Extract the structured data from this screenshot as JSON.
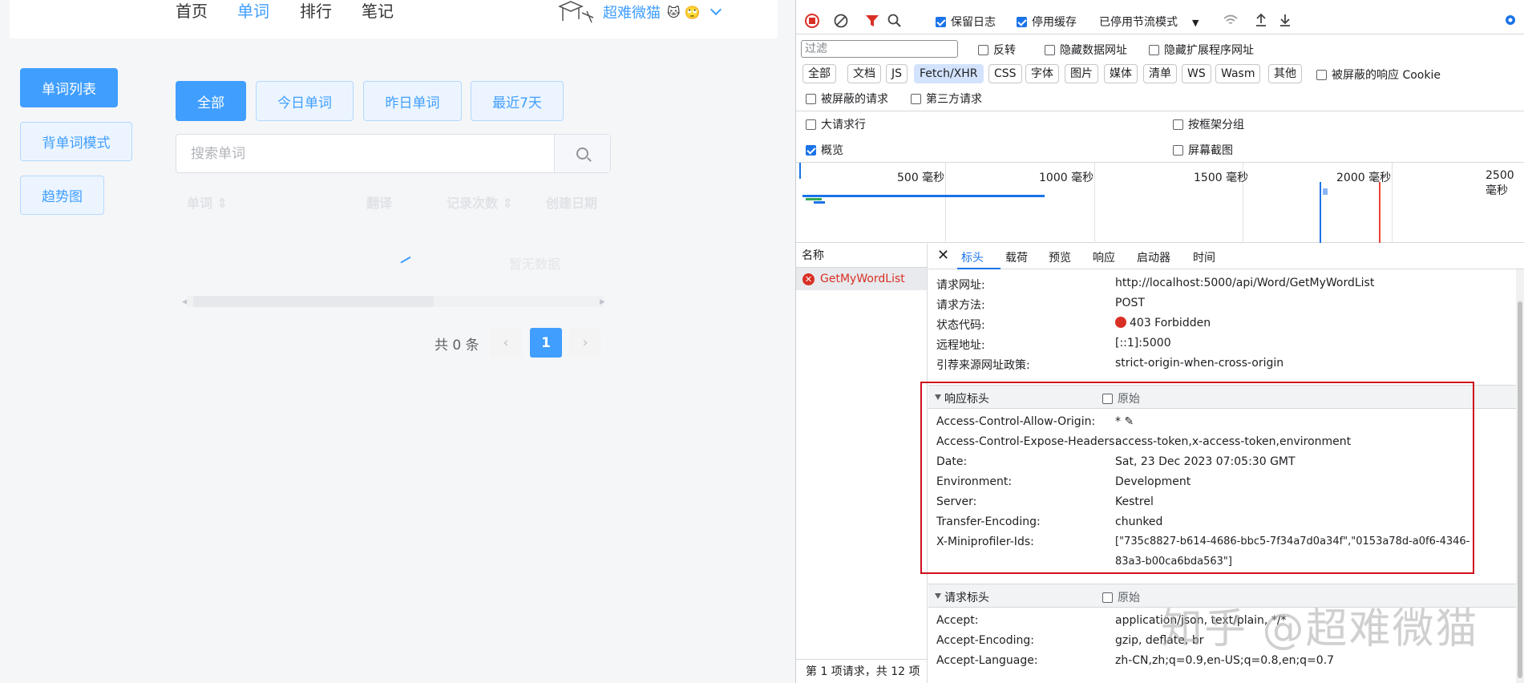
{
  "app": {
    "nav": [
      "首页",
      "单词",
      "排行",
      "笔记"
    ],
    "user": {
      "name": "超难微猫",
      "emojis": "🐱 🙄"
    },
    "sidebar": [
      "单词列表",
      "背单词模式",
      "趋势图"
    ],
    "filters": [
      "全部",
      "今日单词",
      "昨日单词",
      "最近7天"
    ],
    "search_placeholder": "搜索单词",
    "table_headers": [
      "单词 ⇕",
      "翻译",
      "记录次数 ⇕",
      "创建日期"
    ],
    "empty_text": "暂无数据",
    "pagination": {
      "total_text": "共 0 条",
      "current": "1",
      "prev": "‹",
      "next": "›"
    }
  },
  "devtools": {
    "toolbar": {
      "preserve_log": "保留日志",
      "disable_cache": "停用缓存",
      "throttle": "已停用节流模式"
    },
    "filter": {
      "placeholder": "过滤",
      "invert": "反转",
      "hide_data_urls": "隐藏数据网址",
      "hide_ext_urls": "隐藏扩展程序网址",
      "types": [
        "全部",
        "文档",
        "JS",
        "Fetch/XHR",
        "CSS",
        "字体",
        "图片",
        "媒体",
        "清单",
        "WS",
        "Wasm",
        "其他"
      ],
      "blocked_cookies": "被屏蔽的响应 Cookie",
      "blocked_requests": "被屏蔽的请求",
      "third_party": "第三方请求",
      "big_rows": "大请求行",
      "group_by_frame": "按框架分组",
      "overview": "概览",
      "screenshots": "屏幕截图"
    },
    "timeline_labels": [
      "500 毫秒",
      "1000 毫秒",
      "1500 毫秒",
      "2000 毫秒",
      "2500 毫秒"
    ],
    "names": {
      "header": "名称",
      "request": "GetMyWordList",
      "footer": "第 1 项请求，共 12 项"
    },
    "tabs": [
      "标头",
      "载荷",
      "预览",
      "响应",
      "启动器",
      "时间"
    ],
    "general": [
      {
        "k": "请求网址:",
        "v": "http://localhost:5000/api/Word/GetMyWordList"
      },
      {
        "k": "请求方法:",
        "v": "POST"
      },
      {
        "k": "状态代码:",
        "v": "403 Forbidden"
      },
      {
        "k": "远程地址:",
        "v": "[::1]:5000"
      },
      {
        "k": "引荐来源网址政策:",
        "v": "strict-origin-when-cross-origin"
      }
    ],
    "response_headers_title": "响应标头",
    "raw_label": "原始",
    "response_headers": [
      {
        "k": "Access-Control-Allow-Origin:",
        "v": "* ✎"
      },
      {
        "k": "Access-Control-Expose-Headers:",
        "v": "access-token,x-access-token,environment"
      },
      {
        "k": "Date:",
        "v": "Sat, 23 Dec 2023 07:05:30 GMT"
      },
      {
        "k": "Environment:",
        "v": "Development"
      },
      {
        "k": "Server:",
        "v": "Kestrel"
      },
      {
        "k": "Transfer-Encoding:",
        "v": "chunked"
      },
      {
        "k": "X-Miniprofiler-Ids:",
        "v": "[\"735c8827-b614-4686-bbc5-7f34a7d0a34f\",\"0153a78d-a0f6-4346-"
      }
    ],
    "miniprofiler_cont": "83a3-b00ca6bda563\"]",
    "request_headers_title": "请求标头",
    "request_headers": [
      {
        "k": "Accept:",
        "v": "application/json, text/plain, */*"
      },
      {
        "k": "Accept-Encoding:",
        "v": "gzip, deflate, br"
      },
      {
        "k": "Accept-Language:",
        "v": "zh-CN,zh;q=0.9,en-US;q=0.8,en;q=0.7"
      }
    ],
    "watermark": "知乎 @超难微猫"
  },
  "colors": {
    "primary": "#409eff",
    "devtools_blue": "#1a73e8",
    "error_red": "#d93025",
    "highlight_box": "#d0101b"
  }
}
